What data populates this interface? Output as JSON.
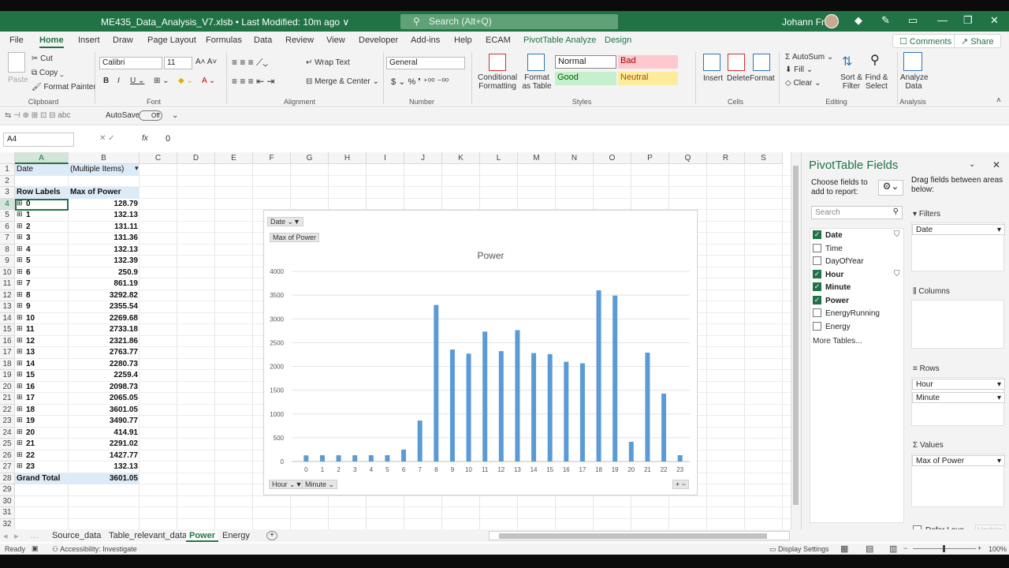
{
  "titlebar": {
    "title": "ME435_Data_Analysis_V7.xlsb  •  Last Modified: 10m ago  ∨",
    "search_placeholder": "Search (Alt+Q)",
    "user": "Johann Fritz"
  },
  "menu": [
    "File",
    "Home",
    "Insert",
    "Draw",
    "Page Layout",
    "Formulas",
    "Data",
    "Review",
    "View",
    "Developer",
    "Add-ins",
    "Help",
    "ECAM",
    "PivotTable Analyze",
    "Design"
  ],
  "top_buttons": {
    "comments": "Comments",
    "share": "Share"
  },
  "ribbon": {
    "clipboard": {
      "paste": "Paste",
      "cut": "Cut",
      "copy": "Copy",
      "format_painter": "Format Painter",
      "label": "Clipboard"
    },
    "font": {
      "name": "Calibri",
      "size": "11",
      "label": "Font"
    },
    "alignment": {
      "wrap": "Wrap Text",
      "merge": "Merge & Center",
      "label": "Alignment"
    },
    "number": {
      "format": "General",
      "label": "Number"
    },
    "styles": {
      "conditional": "Conditional Formatting",
      "format_table": "Format as Table",
      "normal": "Normal",
      "bad": "Bad",
      "good": "Good",
      "neutral": "Neutral",
      "label": "Styles"
    },
    "cells": {
      "insert": "Insert",
      "delete": "Delete",
      "format": "Format",
      "label": "Cells"
    },
    "editing": {
      "autosum": "AutoSum",
      "fill": "Fill",
      "clear": "Clear",
      "sort": "Sort & Filter",
      "find": "Find & Select",
      "label": "Editing"
    },
    "analysis": {
      "analyze": "Analyze Data",
      "label": "Analysis"
    }
  },
  "qat": {
    "autosave": "AutoSave",
    "toggle": "Off"
  },
  "formula_bar": {
    "name_box": "A4",
    "fx": "fx",
    "value": "0"
  },
  "columns": [
    "A",
    "B",
    "C",
    "D",
    "E",
    "F",
    "G",
    "H",
    "I",
    "J",
    "K",
    "L",
    "M",
    "N",
    "O",
    "P",
    "Q",
    "R",
    "S"
  ],
  "pivot": {
    "filter_label": "Date",
    "filter_value": "(Multiple Items)",
    "row_labels": "Row Labels",
    "value_header": "Max of Power",
    "rows": [
      {
        "label": "0",
        "value": "128.79"
      },
      {
        "label": "1",
        "value": "132.13"
      },
      {
        "label": "2",
        "value": "131.11"
      },
      {
        "label": "3",
        "value": "131.36"
      },
      {
        "label": "4",
        "value": "132.13"
      },
      {
        "label": "5",
        "value": "132.39"
      },
      {
        "label": "6",
        "value": "250.9"
      },
      {
        "label": "7",
        "value": "861.19"
      },
      {
        "label": "8",
        "value": "3292.82"
      },
      {
        "label": "9",
        "value": "2355.54"
      },
      {
        "label": "10",
        "value": "2269.68"
      },
      {
        "label": "11",
        "value": "2733.18"
      },
      {
        "label": "12",
        "value": "2321.86"
      },
      {
        "label": "13",
        "value": "2763.77"
      },
      {
        "label": "14",
        "value": "2280.73"
      },
      {
        "label": "15",
        "value": "2259.4"
      },
      {
        "label": "16",
        "value": "2098.73"
      },
      {
        "label": "17",
        "value": "2065.05"
      },
      {
        "label": "18",
        "value": "3601.05"
      },
      {
        "label": "19",
        "value": "3490.77"
      },
      {
        "label": "20",
        "value": "414.91"
      },
      {
        "label": "21",
        "value": "2291.02"
      },
      {
        "label": "22",
        "value": "1427.77"
      },
      {
        "label": "23",
        "value": "132.13"
      }
    ],
    "grand_total_label": "Grand Total",
    "grand_total_value": "3601.05"
  },
  "chart_buttons": {
    "filter": "Date",
    "value": "Max of Power",
    "axis1": "Hour",
    "axis2": "Minute"
  },
  "chart_data": {
    "type": "bar",
    "title": "Power",
    "categories": [
      "0",
      "1",
      "2",
      "3",
      "4",
      "5",
      "6",
      "7",
      "8",
      "9",
      "10",
      "11",
      "12",
      "13",
      "14",
      "15",
      "16",
      "17",
      "18",
      "19",
      "20",
      "21",
      "22",
      "23"
    ],
    "series": [
      {
        "values": [
          128.79,
          132.13,
          131.11,
          131.36,
          132.13,
          132.39,
          250.9,
          861.19,
          3292.82,
          2355.54,
          2269.68,
          2733.18,
          2321.86,
          2763.77,
          2280.73,
          2259.4,
          2098.73,
          2065.05,
          3601.05,
          3490.77,
          414.91,
          2291.02,
          1427.77,
          132.13
        ]
      }
    ],
    "ylim": [
      0,
      4000
    ],
    "yticks": [
      "0",
      "500",
      "1000",
      "1500",
      "2000",
      "2500",
      "3000",
      "3500",
      "4000"
    ],
    "color": "#5b9bd5",
    "grid": true
  },
  "pane": {
    "title": "PivotTable Fields",
    "choose": "Choose fields to add to report:",
    "drag": "Drag fields between areas below:",
    "search_placeholder": "Search",
    "fields": [
      {
        "name": "Date",
        "checked": true,
        "bold": true
      },
      {
        "name": "Time",
        "checked": false,
        "bold": false
      },
      {
        "name": "DayOfYear",
        "checked": false,
        "bold": false
      },
      {
        "name": "Hour",
        "checked": true,
        "bold": true
      },
      {
        "name": "Minute",
        "checked": true,
        "bold": true
      },
      {
        "name": "Power",
        "checked": true,
        "bold": true
      },
      {
        "name": "EnergyRunning",
        "checked": false,
        "bold": false
      },
      {
        "name": "Energy",
        "checked": false,
        "bold": false
      }
    ],
    "more_tables": "More Tables...",
    "filters_label": "Filters",
    "filters_item": "Date",
    "columns_label": "Columns",
    "rows_label": "Rows",
    "rows_items": [
      "Hour",
      "Minute"
    ],
    "values_label": "Values",
    "values_item": "Max of Power",
    "defer": "Defer Layo...",
    "update": "Update"
  },
  "sheets": [
    "Source_data",
    "Table_relevant_data",
    "Power",
    "Energy"
  ],
  "active_sheet": "Power",
  "status": {
    "ready": "Ready",
    "accessibility": "Accessibility: Investigate",
    "display": "Display Settings",
    "zoom": "100%"
  }
}
